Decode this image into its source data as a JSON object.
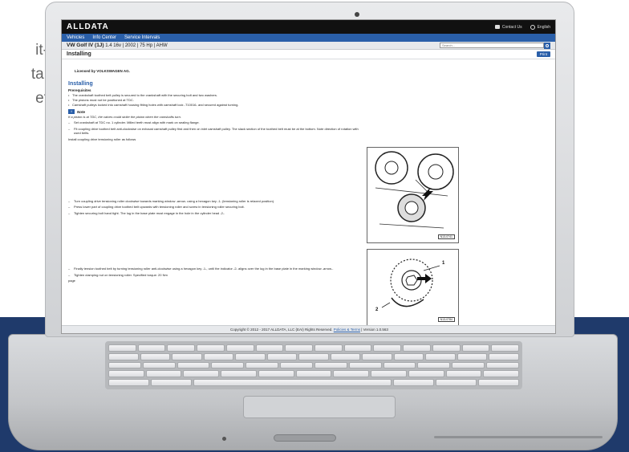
{
  "background_text": {
    "line1": "it-",
    "line2": "ta.",
    "line3": "et"
  },
  "app": {
    "logo": "ALLDATA",
    "top_right": {
      "contact": "Contact Us",
      "language": "English"
    },
    "nav": [
      "Vehicles",
      "Info Center",
      "Service Intervals"
    ],
    "vehicle": {
      "name": "VW Golf IV (1J)",
      "details": "1.4 16v | 2002 | 75 Hp | AHW"
    },
    "search_placeholder": "Search...",
    "page_title": "Installing",
    "print_label": "Print"
  },
  "document": {
    "licensed": "Licensed by VOLKSWAGEN AG.",
    "heading": "Installing",
    "prereq_label": "Prerequisites",
    "prereqs": [
      "The crankshaft toothed belt pulley is secured to the crankshaft with the securing bolt and two washers.",
      "The pistons must not be positioned at TDC.",
      "Camshaft pulleys locked into camshaft housing fitting holes with camshaft lock -T10016- and secured against turning."
    ],
    "note_label": "Note",
    "note_text": "If a piston is at TDC, the valves could strike the piston when the camshafts turn.",
    "steps_a": [
      "Set crankshaft at TDC no. 1 cylinder. Milled teeth must align with mark on sealing flange.",
      "Fit coupling drive toothed belt anti-clockwise on exhaust camshaft pulley first and then on inlet camshaft pulley. The slack section of the toothed belt must be at the bottom. Note direction of rotation with used belts."
    ],
    "plain_a": "Install coupling drive tensioning roller as follows",
    "steps_b": [
      "Turn coupling drive tensioning roller clockwise towards marking window -arrow- using a hexagon key -1- (tensioning roller is relaxed position).",
      "Press lower part of coupling drive toothed belt upwards with tensioning roller and screw in tensioning roller securing bolt.",
      "Tighten securing bolt hand tight. The lug in the base plate must engage in the hole in the cylinder head -2-."
    ],
    "steps_c": [
      "Finally tension toothed belt by turning tensioning roller anti-clockwise using a hexagon key -1-, until the indicator -2- aligns over the lug in the base plate in the marking window -arrow-.",
      "Tighten clamping nut on tensioning roller. Specified torque: 20 Nm"
    ],
    "plain_c": "page",
    "figures": [
      {
        "code": "N13-0741",
        "labels": []
      },
      {
        "code": "N13-0784",
        "labels": [
          "1",
          "2"
        ]
      },
      {
        "code": "",
        "labels": [
          "1"
        ]
      }
    ],
    "footer_text": "Copyright © 2012 - 2017 ALLDATA, LLC (EAI) Rights Reserved.",
    "footer_link": "Policies & Terms",
    "footer_version": "| Version 1.0.563"
  },
  "colors": {
    "accent": "#2a5fa9",
    "topbar": "#111111",
    "band": "#1f3a6b"
  }
}
